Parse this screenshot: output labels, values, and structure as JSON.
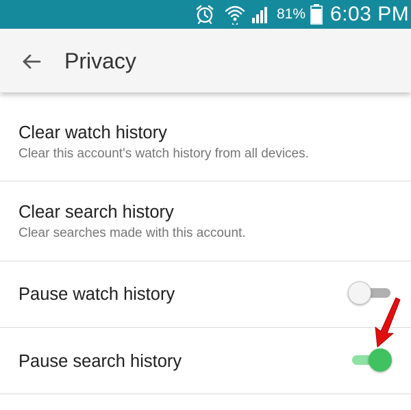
{
  "status_bar": {
    "battery_percent": "81%",
    "time": "6:03 PM",
    "icons": [
      "alarm-icon",
      "wifi-icon",
      "signal-icon",
      "battery-icon"
    ],
    "background": "#168a9d"
  },
  "app_bar": {
    "back_icon": "arrow-left-icon",
    "title": "Privacy"
  },
  "settings": {
    "clear_watch": {
      "title": "Clear watch history",
      "subtitle": "Clear this account's watch history from all devices."
    },
    "clear_search": {
      "title": "Clear search history",
      "subtitle": "Clear searches made with this account."
    },
    "pause_watch": {
      "title": "Pause watch history",
      "toggle_on": false
    },
    "pause_search": {
      "title": "Pause search history",
      "toggle_on": true
    }
  },
  "colors": {
    "toggle_on_thumb": "#3fc25f",
    "toggle_on_track": "#8ee0a3",
    "toggle_off_track": "#b0b0b0",
    "annotation_arrow": "#e01010"
  }
}
